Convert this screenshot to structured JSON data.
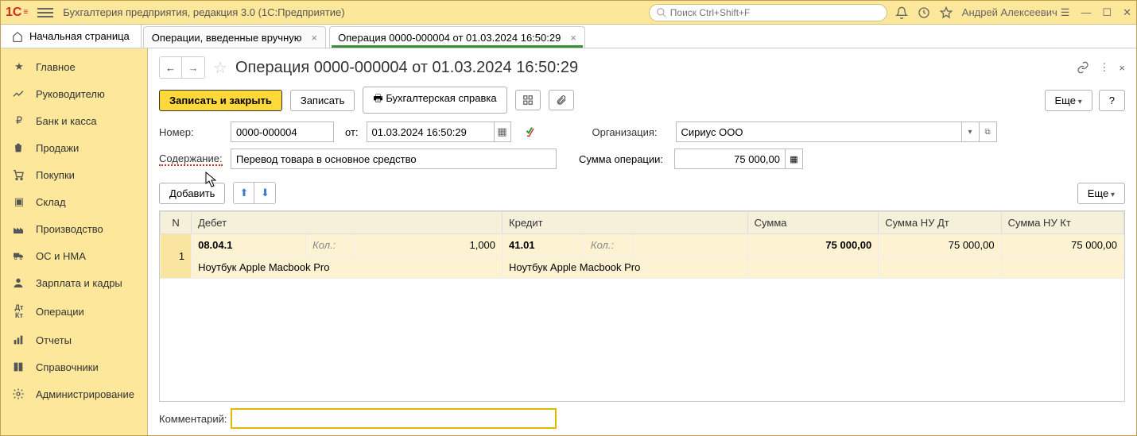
{
  "app": {
    "title": "Бухгалтерия предприятия, редакция 3.0  (1С:Предприятие)"
  },
  "search": {
    "placeholder": "Поиск Ctrl+Shift+F"
  },
  "user": {
    "name": "Андрей Алексеевич"
  },
  "tabs": {
    "home": "Начальная страница",
    "t1": "Операции, введенные вручную",
    "t2": "Операция 0000-000004 от 01.03.2024 16:50:29"
  },
  "sidebar": {
    "items": [
      "Главное",
      "Руководителю",
      "Банк и касса",
      "Продажи",
      "Покупки",
      "Склад",
      "Производство",
      "ОС и НМА",
      "Зарплата и кадры",
      "Операции",
      "Отчеты",
      "Справочники",
      "Администрирование"
    ]
  },
  "doc": {
    "title": "Операция 0000-000004 от 01.03.2024 16:50:29",
    "save_close": "Записать и закрыть",
    "save": "Записать",
    "acc_report": "Бухгалтерская справка",
    "more": "Еще",
    "help": "?",
    "number_lbl": "Номер:",
    "number": "0000-000004",
    "from_lbl": "от:",
    "date": "01.03.2024 16:50:29",
    "org_lbl": "Организация:",
    "org": "Сириус ООО",
    "content_lbl": "Содержание:",
    "content": "Перевод товара в основное средство",
    "sum_lbl": "Сумма операции:",
    "sum": "75 000,00",
    "add": "Добавить",
    "comment_lbl": "Комментарий:",
    "comment": ""
  },
  "table": {
    "headers": {
      "n": "N",
      "dt": "Дебет",
      "kt": "Кредит",
      "sum": "Сумма",
      "nu_dt": "Сумма НУ Дт",
      "nu_kt": "Сумма НУ Кт",
      "qty": "Кол.:"
    },
    "rows": [
      {
        "n": "1",
        "dt_acc": "08.04.1",
        "dt_qty": "1,000",
        "dt_item": "Ноутбук Apple Macbook Pro",
        "kt_acc": "41.01",
        "kt_item": "Ноутбук Apple Macbook Pro",
        "sum": "75 000,00",
        "nu_dt": "75 000,00",
        "nu_kt": "75 000,00"
      }
    ]
  }
}
